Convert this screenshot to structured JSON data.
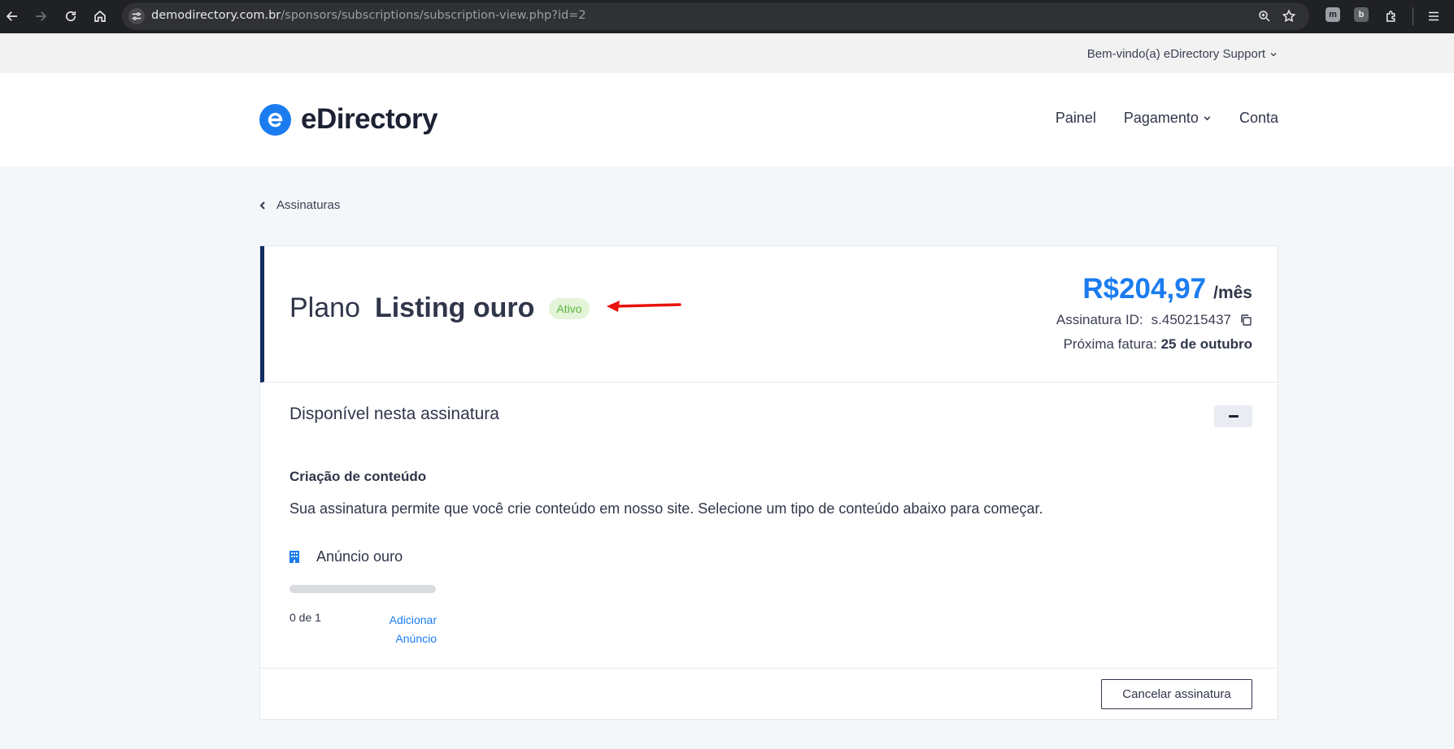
{
  "browser": {
    "url_host": "demodirectory.com.br",
    "url_path": "/sponsors/subscriptions/subscription-view.php?id=2",
    "extensions": [
      "m",
      "b"
    ]
  },
  "userbar": {
    "welcome": "Bem-vindo(a) eDirectory Support"
  },
  "header": {
    "logo_text": "eDirectory",
    "nav": [
      {
        "label": "Painel"
      },
      {
        "label": "Pagamento"
      },
      {
        "label": "Conta"
      }
    ]
  },
  "breadcrumb": {
    "label": "Assinaturas"
  },
  "subscription": {
    "plan_label": "Plano",
    "plan_name": "Listing ouro",
    "status": "Ativo",
    "price": "R$204,97",
    "price_period": "/mês",
    "id_label": "Assinatura ID:",
    "id_value": "s.450215437",
    "invoice_label": "Próxima fatura:",
    "invoice_date": "25 de outubro"
  },
  "features": {
    "section_title": "Disponível nesta assinatura",
    "content_heading": "Criação de conteúdo",
    "content_desc": "Sua assinatura permite que você crie conteúdo em nosso site. Selecione um tipo de conteúdo abaixo para começar.",
    "items": [
      {
        "label": "Anúncio ouro",
        "used": 0,
        "total": 1,
        "count_text": "0 de 1",
        "add_label": "Adicionar Anúncio"
      }
    ]
  },
  "footer": {
    "cancel_label": "Cancelar assinatura"
  },
  "colors": {
    "accent": "#1b7cf0",
    "status_bg": "#e3f4d9",
    "status_text": "#5cb23a",
    "card_border_left": "#0d2c61",
    "annotation_arrow": "#e8120c"
  }
}
